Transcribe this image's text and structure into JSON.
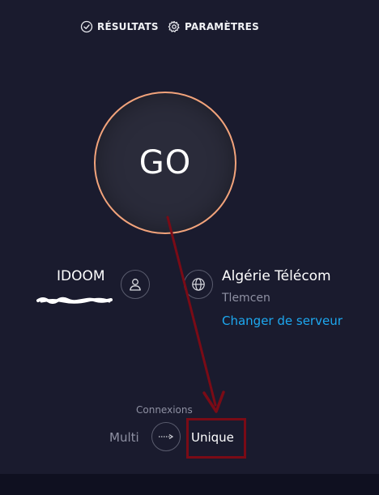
{
  "nav": {
    "results_label": "RÉSULTATS",
    "settings_label": "PARAMÈTRES",
    "results_icon": "check-circle-icon",
    "settings_icon": "gear-icon"
  },
  "go_button": {
    "label": "GO"
  },
  "provider": {
    "name": "IDOOM",
    "icon": "user-icon"
  },
  "server": {
    "name": "Algérie Télécom",
    "city": "Tlemcen",
    "change_label": "Changer de serveur",
    "icon": "globe-icon"
  },
  "connections": {
    "label": "Connexions",
    "multi_label": "Multi",
    "single_label": "Unique",
    "selected": "Unique",
    "toggle_icon": "arrow-right-icon"
  },
  "colors": {
    "background": "#1a1b2e",
    "go_ring": "#f2a37b",
    "link": "#1da8f0",
    "annotation": "#7a0b16"
  }
}
